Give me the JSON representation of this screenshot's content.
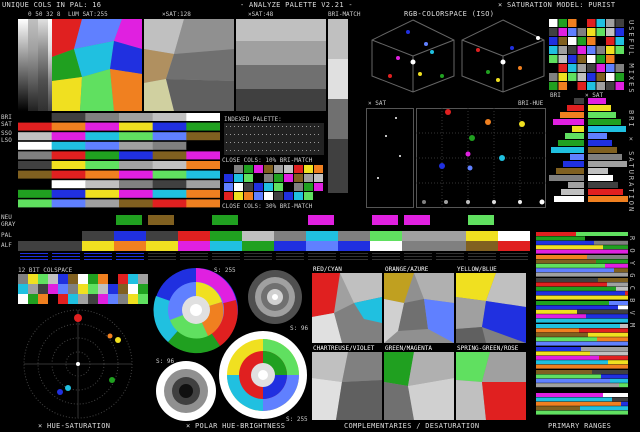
{
  "header": {
    "left_title": "UNIQUE COLS IN PAL: 16",
    "center_title": "- ANALYZE PALETTE V2.21 -",
    "right_title": "× SATURATION MODEL: PURIST",
    "lum_sat": "LUM SAT:255",
    "sat128": "×SAT:128",
    "sat48": "×SAT:48",
    "bri_match": "BRI-MATCH",
    "rgb_colorspace": "RGB-COLORSPACE (ISO)",
    "lum_nums": "0 50 32 8"
  },
  "palette": {
    "colors": [
      "#000000",
      "#ffffff",
      "#c0c0c0",
      "#808080",
      "#404040",
      "#e02020",
      "#20a020",
      "#2030e0",
      "#f0e020",
      "#e020e0",
      "#20c0e0",
      "#f08020",
      "#806020",
      "#60e060",
      "#6080ff",
      "#a0a0a0"
    ]
  },
  "left_labels": {
    "bri": "BRI",
    "sat": "SAT",
    "sso": "SSO",
    "lso": "LSO",
    "neu": "NEU",
    "gray": "GRAY",
    "pal": "PAL",
    "alf": "ALF"
  },
  "indexed": {
    "title": "INDEXED PALETTE:",
    "close1": "CLOSE COLS: 10% BRI-MATCH",
    "close2": "CLOSE COLS: 30% BRI-MATCH"
  },
  "scatter": {
    "sat_label": "× SAT",
    "bri_hue": "BRI-HUE",
    "sat_label2": "× SAT",
    "bri_label": "BRI"
  },
  "side_vertical": {
    "useful_mixes": "USEFUL MIXES",
    "bri_saturation": "BRI × SATURATION",
    "roygcbvm": "R O Y G C B V M"
  },
  "colspace": {
    "title": "12 BIT COLSPACE"
  },
  "polar": {
    "s255a": "S: 255",
    "s96a": "S: 96",
    "s96b": "S: 96",
    "s255b": "S: 255"
  },
  "complements": {
    "red_cyan": "RED/CYAN",
    "orange_azure": "ORANGE/AZURE",
    "yellow_blue": "YELLOW/BLUE",
    "chartreuse_violet": "CHARTREUSE/VIOLET",
    "green_magenta": "GREEN/MAGENTA",
    "spring_rose": "SPRING-GREEN/ROSE"
  },
  "footer": {
    "hue_sat": "× HUE-SATURATION",
    "polar_hue": "× POLAR HUE-BRIGHTNESS",
    "complementaries": "COMPLEMENTARIES / DESATURATION",
    "primary_ranges": "PRIMARY RANGES"
  }
}
